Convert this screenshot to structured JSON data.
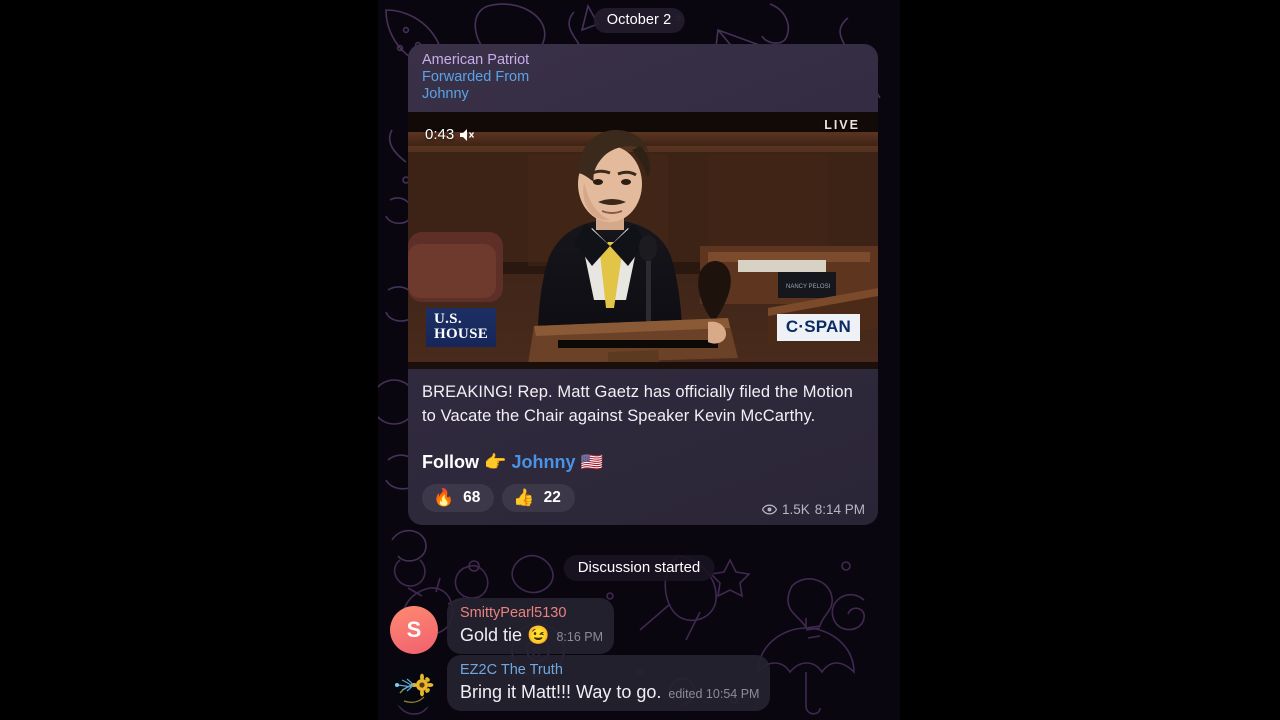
{
  "date_badge": "October 2",
  "forward": {
    "channel": "American Patriot",
    "forwarded_label": "Forwarded From",
    "forwarded_from": "Johnny"
  },
  "video": {
    "timer": "0:43",
    "mute_icon": "muted-speaker-icon",
    "live_label": "LIVE",
    "logo_ushouse_line1": "U.S.",
    "logo_ushouse_line2": "HOUSE",
    "logo_cspan": "C·SPAN"
  },
  "caption": {
    "body": "BREAKING! Rep. Matt Gaetz has officially filed the Motion to Vacate the Chair against Speaker Kevin McCarthy.",
    "follow_label": "Follow",
    "follow_pointer": "👉",
    "follow_link": "Johnny",
    "follow_flag": "🇺🇸"
  },
  "reactions": [
    {
      "emoji": "🔥",
      "name": "fire",
      "count": "68"
    },
    {
      "emoji": "👍",
      "name": "thumbs-up",
      "count": "22"
    }
  ],
  "message_meta": {
    "views_icon": "eye-icon",
    "views": "1.5K",
    "time": "8:14 PM"
  },
  "service_message": "Discussion started",
  "comments": [
    {
      "avatar_letter": "S",
      "name": "SmittyPearl5130",
      "text": "Gold tie 😉",
      "time": "8:16 PM"
    },
    {
      "avatar_letter": "",
      "name": "EZ2C The Truth",
      "text": "Bring it Matt!!! Way to go.",
      "time": "edited 10:54 PM"
    }
  ],
  "colors": {
    "channel_name": "#c6aee8",
    "link_blue": "#5aa3e8",
    "comment_name_1": "#e8837f",
    "comment_name_2": "#6fa8e0",
    "background": "#0a0610"
  }
}
